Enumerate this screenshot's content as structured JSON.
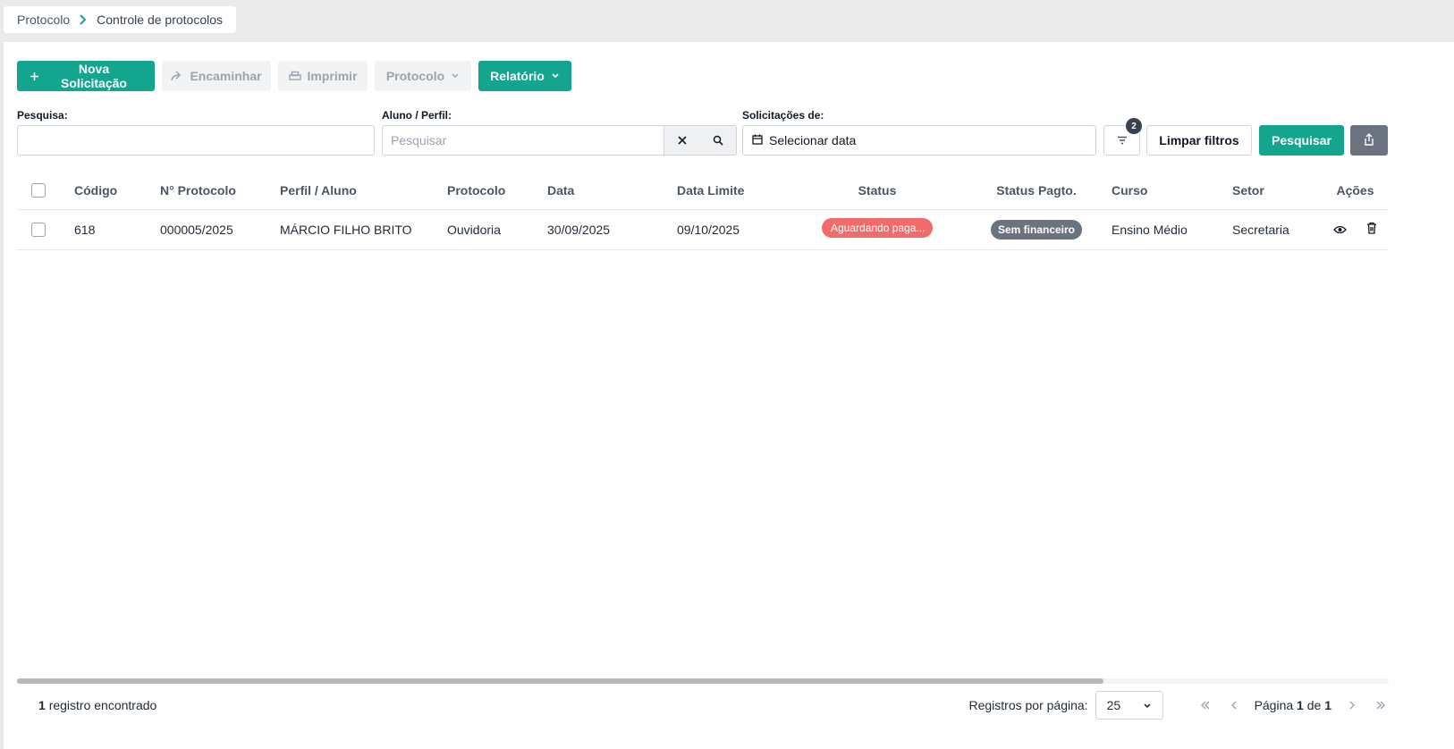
{
  "breadcrumb": {
    "root": "Protocolo",
    "current": "Controle de protocolos"
  },
  "toolbar": {
    "nova": "Nova Solicitação",
    "encaminhar": "Encaminhar",
    "imprimir": "Imprimir",
    "protocolo": "Protocolo",
    "relatorio": "Relatório"
  },
  "filters": {
    "pesquisa_label": "Pesquisa:",
    "pesquisa_value": "",
    "aluno_label": "Aluno / Perfil:",
    "aluno_placeholder": "Pesquisar",
    "solicitacoes_label": "Solicitações de:",
    "date_placeholder": "Selecionar data",
    "filter_count": "2",
    "limpar": "Limpar filtros",
    "pesquisar": "Pesquisar"
  },
  "table": {
    "headers": [
      "Código",
      "N° Protocolo",
      "Perfil / Aluno",
      "Protocolo",
      "Data",
      "Data Limite",
      "Status",
      "Status Pagto.",
      "Curso",
      "Setor",
      "Ações"
    ],
    "rows": [
      {
        "codigo": "618",
        "protocolo_num": "000005/2025",
        "aluno": "MÁRCIO FILHO BRITO",
        "protocolo": "Ouvidoria",
        "data": "30/09/2025",
        "data_limite": "09/10/2025",
        "status": "Aguardando paga...",
        "status_pagto": "Sem financeiro",
        "curso": "Ensino Médio",
        "setor": "Secretaria"
      }
    ]
  },
  "footer": {
    "count_number": "1",
    "count_text": "registro encontrado",
    "per_page_label": "Registros por página:",
    "per_page_value": "25",
    "page_label": "Página",
    "page_current": "1",
    "page_of": "de",
    "page_total": "1"
  },
  "colors": {
    "accent": "#14a58e",
    "status_red": "#f16b6b",
    "status_gray": "#6b7280"
  },
  "icons": [
    "chevron-right-icon",
    "plus-icon",
    "forward-icon",
    "printer-icon",
    "chevron-down-icon",
    "close-icon",
    "search-icon",
    "calendar-icon",
    "filter-icon",
    "export-icon",
    "eye-icon",
    "trash-icon",
    "first-page-icon",
    "prev-page-icon",
    "next-page-icon",
    "last-page-icon"
  ]
}
